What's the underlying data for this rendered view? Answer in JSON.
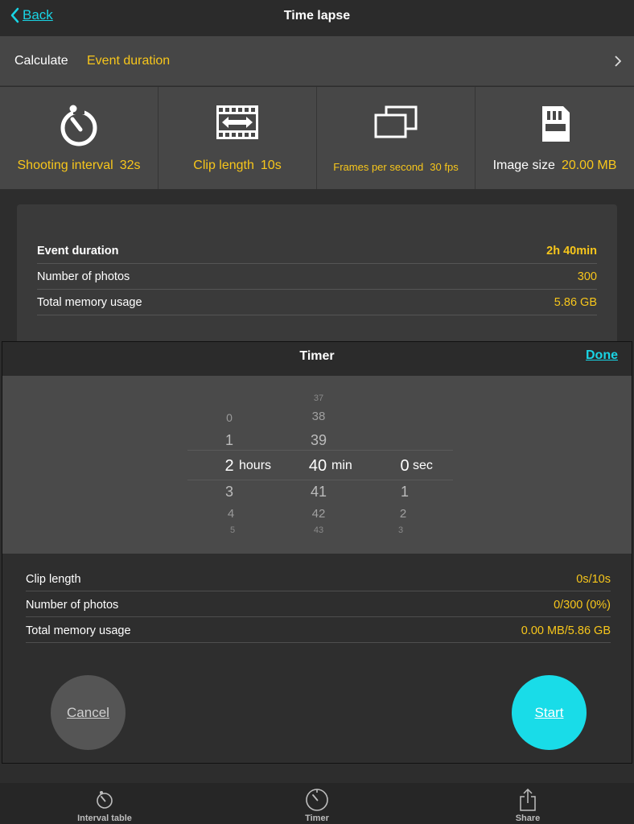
{
  "nav": {
    "back_label": "Back",
    "title": "Time lapse"
  },
  "calculate": {
    "label": "Calculate",
    "value": "Event duration"
  },
  "tiles": [
    {
      "icon": "stopwatch-icon",
      "label": "Shooting interval",
      "value": "32s"
    },
    {
      "icon": "film-strip-icon",
      "label": "Clip length",
      "value": "10s"
    },
    {
      "icon": "frames-icon",
      "label": "Frames per second",
      "value": "30 fps"
    },
    {
      "icon": "sd-card-icon",
      "label": "Image size",
      "value": "20.00 MB"
    }
  ],
  "results": [
    {
      "label": "Event duration",
      "value": "2h 40min"
    },
    {
      "label": "Number of photos",
      "value": "300"
    },
    {
      "label": "Total memory usage",
      "value": "5.86 GB"
    }
  ],
  "timer": {
    "title": "Timer",
    "done_label": "Done",
    "hours": {
      "values": [
        "0",
        "1",
        "2",
        "3",
        "4",
        "5"
      ],
      "selected": "2",
      "unit": "hours"
    },
    "minutes": {
      "values": [
        "37",
        "38",
        "39",
        "40",
        "41",
        "42",
        "43"
      ],
      "selected": "40",
      "unit": "min"
    },
    "seconds": {
      "values": [
        "0",
        "1",
        "2",
        "3"
      ],
      "selected": "0",
      "unit": "sec"
    },
    "stats": [
      {
        "label": "Clip length",
        "value": "0s/10s"
      },
      {
        "label": "Number of photos",
        "value": "0/300 (0%)"
      },
      {
        "label": "Total memory usage",
        "value": "0.00 MB/5.86 GB"
      }
    ],
    "cancel_label": "Cancel",
    "start_label": "Start"
  },
  "tabbar": [
    {
      "icon": "stopwatch-icon",
      "label": "Interval table"
    },
    {
      "icon": "timer-icon",
      "label": "Timer"
    },
    {
      "icon": "share-icon",
      "label": "Share"
    }
  ],
  "colors": {
    "accent": "#f7c61b",
    "link": "#19d4e4",
    "start_button": "#19dce8"
  }
}
